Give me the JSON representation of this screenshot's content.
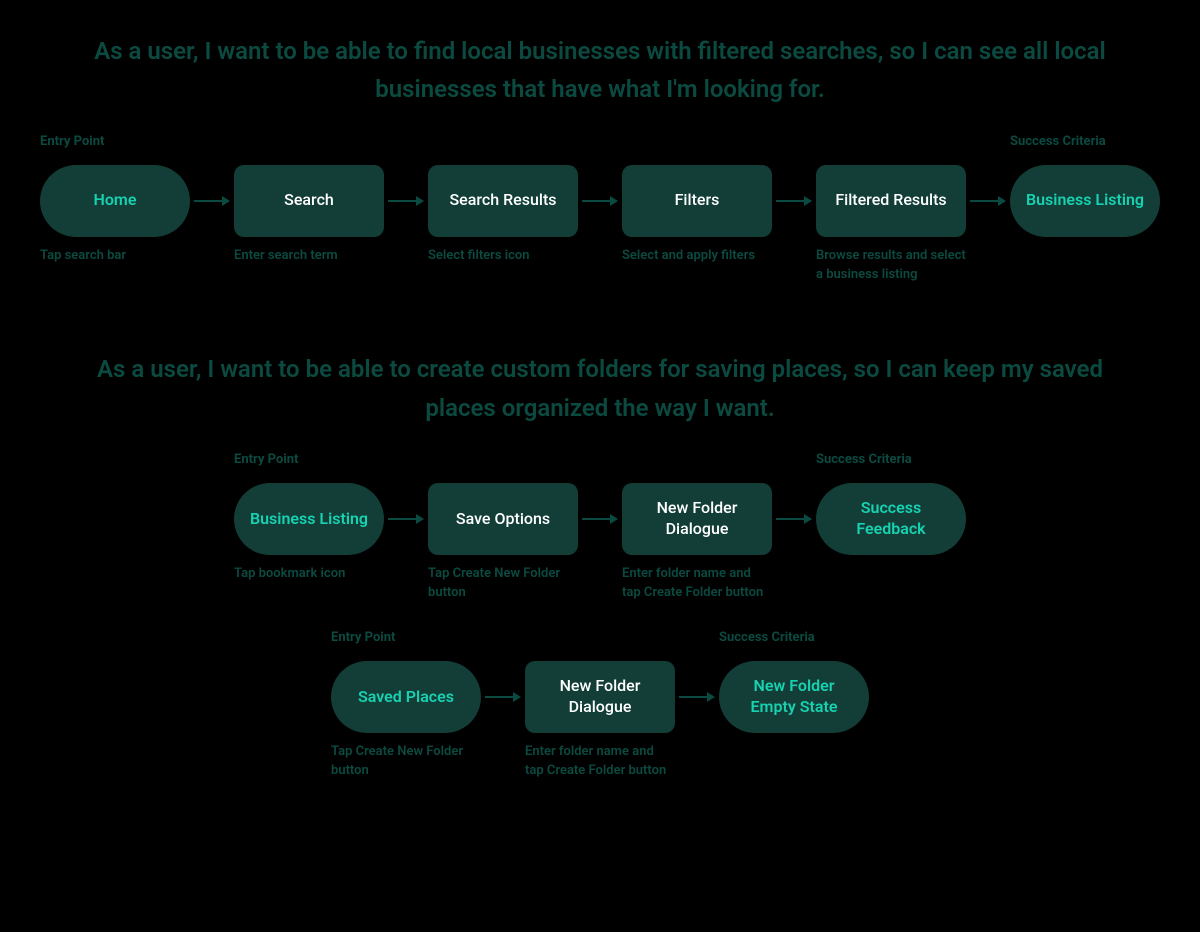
{
  "stories": [
    {
      "heading": "As a user, I want to be able to find local businesses with filtered searches, so I can see all local businesses that have what I'm looking for.",
      "flows": [
        {
          "steps": [
            {
              "kind": "pill",
              "top": "Entry Point",
              "label": "Home",
              "caption": "Tap search bar"
            },
            {
              "kind": "rect",
              "top": "",
              "label": "Search",
              "caption": "Enter search term"
            },
            {
              "kind": "rect",
              "top": "",
              "label": "Search Results",
              "caption": "Select filters icon"
            },
            {
              "kind": "rect",
              "top": "",
              "label": "Filters",
              "caption": "Select and apply filters"
            },
            {
              "kind": "rect",
              "top": "",
              "label": "Filtered Results",
              "caption": "Browse results and select a business listing"
            },
            {
              "kind": "pill",
              "top": "Success Criteria",
              "label": "Business Listing",
              "caption": ""
            }
          ]
        }
      ]
    },
    {
      "heading": "As a user, I want to be able to create custom folders for saving places, so I can keep my saved places organized the way I want.",
      "flows": [
        {
          "steps": [
            {
              "kind": "pill",
              "top": "Entry Point",
              "label": "Business Listing",
              "caption": "Tap bookmark icon"
            },
            {
              "kind": "rect",
              "top": "",
              "label": "Save Options",
              "caption": "Tap Create New Folder button"
            },
            {
              "kind": "rect",
              "top": "",
              "label": "New Folder Dialogue",
              "caption": "Enter folder name and tap Create Folder button"
            },
            {
              "kind": "pill",
              "top": "Success Criteria",
              "label": "Success Feedback",
              "caption": ""
            }
          ]
        },
        {
          "steps": [
            {
              "kind": "pill",
              "top": "Entry Point",
              "label": "Saved Places",
              "caption": "Tap Create New Folder button"
            },
            {
              "kind": "rect",
              "top": "",
              "label": "New Folder Dialogue",
              "caption": "Enter folder name and tap Create Folder button"
            },
            {
              "kind": "pill",
              "top": "Success Criteria",
              "label": "New Folder Empty State",
              "caption": ""
            }
          ]
        }
      ]
    }
  ]
}
